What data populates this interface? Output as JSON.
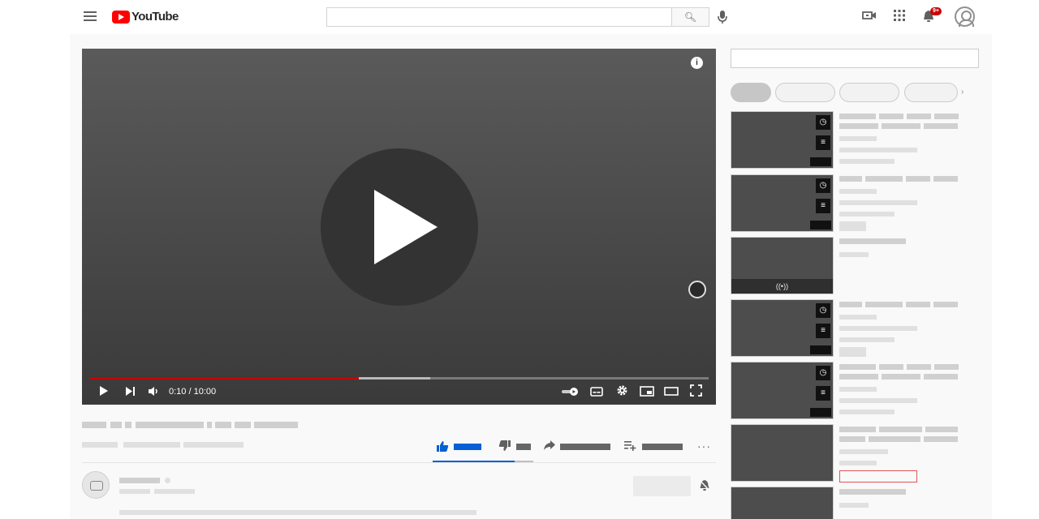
{
  "header": {
    "logo_text": "YouTube",
    "search_placeholder": "",
    "search_icon": "search-icon",
    "mic_icon": "mic-icon",
    "create_icon": "video-camera-icon",
    "apps_icon": "grid-icon",
    "notifications_icon": "bell-icon",
    "notifications_badge": "9+",
    "account_icon": "account-icon"
  },
  "player": {
    "time_display": "0:10 / 10:00",
    "progress_fraction": 0.0167,
    "buffer_fraction": 0.55,
    "played_visual_fraction": 0.435,
    "icons": [
      "play-icon",
      "next-icon",
      "volume-icon",
      "autoplay-toggle-icon",
      "subtitles-icon",
      "settings-icon",
      "miniplayer-icon",
      "theater-icon",
      "fullscreen-icon"
    ],
    "live_label": "((•))"
  },
  "actions": {
    "like_icon": "thumb-up-icon",
    "dislike_icon": "thumb-down-icon",
    "share_icon": "share-icon",
    "save_icon": "playlist-add-icon",
    "more_icon": "more-icon",
    "more_label": "···"
  },
  "colors": {
    "accent_red": "#cc0000",
    "like_blue": "#065fd4",
    "placeholder_gray": "#d0d0d0"
  },
  "sidebar": {
    "chip_count": 4,
    "chip_arrow": "›"
  }
}
